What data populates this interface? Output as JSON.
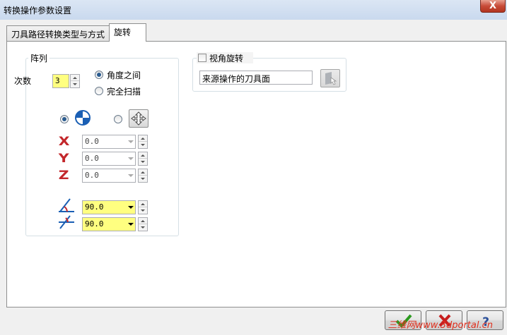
{
  "window": {
    "title": "转换操作参数设置",
    "close_label": "X"
  },
  "tabs": [
    {
      "label": "刀具路径转换类型与方式",
      "active": false
    },
    {
      "label": "旋转",
      "active": true
    }
  ],
  "array_group": {
    "label": "阵列",
    "count_label": "次数",
    "count_value": "3",
    "radio_between_angles": "角度之间",
    "radio_full_sweep": "完全扫描",
    "x_value": "0.0",
    "y_value": "0.0",
    "z_value": "0.0",
    "angle1_value": "90.0",
    "angle2_value": "90.0"
  },
  "view_rotate": {
    "checkbox_label": "视角旋转",
    "checked": false,
    "source_field_value": "来源操作的刀具面"
  },
  "footer": {
    "watermark": "三维网www.3dportal.cn"
  },
  "colors": {
    "axis_icon": "#c3272b",
    "highlight_field": "#ffff80",
    "ok_check": "#2a9a1e",
    "cancel_x": "#c71e1e",
    "help_q": "#2a4f9a"
  }
}
